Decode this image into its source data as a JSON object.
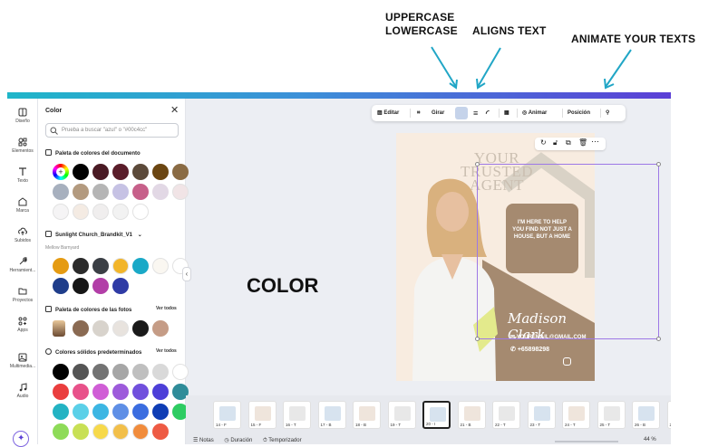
{
  "annotations": {
    "uppercase": "UPPERCASE",
    "lowercase": "LOWERCASE",
    "aligns": "ALIGNS TEXT",
    "animate": "ANIMATE YOUR TEXTS",
    "color": "COLOR"
  },
  "rail": [
    {
      "label": "Diseño",
      "icon": "layout-icon"
    },
    {
      "label": "Elementos",
      "icon": "elements-icon"
    },
    {
      "label": "Texto",
      "icon": "text-icon"
    },
    {
      "label": "Marca",
      "icon": "brand-icon"
    },
    {
      "label": "Subidos",
      "icon": "upload-icon"
    },
    {
      "label": "Herramient...",
      "icon": "tools-icon"
    },
    {
      "label": "Proyectos",
      "icon": "folder-icon"
    },
    {
      "label": "Apps",
      "icon": "apps-icon"
    },
    {
      "label": "Multimedia...",
      "icon": "media-icon"
    },
    {
      "label": "Audio",
      "icon": "audio-icon"
    }
  ],
  "panel": {
    "title": "Color",
    "search_placeholder": "Prueba a buscar \"azul\" o \"#00c4cc\"",
    "doc_palette_title": "Paleta de colores del documento",
    "brandkit_title": "Sunlight Church_Brandkit_V1",
    "brandkit_sub": "Mellow Barnyard",
    "photo_palette_title": "Paleta de colores de las fotos",
    "photo_see_all": "Ver todos",
    "solid_title": "Colores sólidos predeterminados",
    "solid_see_all": "Ver todos",
    "doc_colors": [
      "#000000",
      "#4a1a24",
      "#5a1d2a",
      "#5c4a3a",
      "#6b4612",
      "#8a6b44",
      "#a7b0be",
      "#b39a7f",
      "#b5b5b5",
      "#c6c2e4",
      "#c7608a",
      "#e2d8e5",
      "#f1e4e6",
      "#f5f4f5",
      "#f4ebe3",
      "#f0eeee",
      "#f2f2f2",
      "#ffffff"
    ],
    "brand_colors": [
      "#e59b12",
      "#2b2b2b",
      "#3b3f45",
      "#f2b52a",
      "#1aa9c7",
      "#faf7f1",
      "#ffffff",
      "#1f3d8a",
      "#161616",
      "#b23ea7",
      "#2f3ba5"
    ],
    "photo_colors": [
      "#8a6a52",
      "#d8d3cc",
      "#e8e3de",
      "#1a1a1a",
      "#c59c86"
    ],
    "solid_colors": [
      "#000000",
      "#555555",
      "#737373",
      "#a6a6a6",
      "#bfbfbf",
      "#d9d9d9",
      "#ffffff",
      "#ea3e3e",
      "#e8528a",
      "#d05ed6",
      "#9d5bdb",
      "#7150dd",
      "#4d3fd8",
      "#2f8c99",
      "#23b3c3",
      "#5bd0e8",
      "#3cb6e3",
      "#5f8fe6",
      "#3b6de0",
      "#0f3db5",
      "#2ecc62",
      "#8edb58",
      "#c8e055",
      "#f7d94b",
      "#f2bf4a",
      "#f18c3c",
      "#ee5b44"
    ]
  },
  "toolbar": {
    "edit": "Editar",
    "rotate": "Girar",
    "animate": "Animar",
    "position": "Posición"
  },
  "design": {
    "headline": "YOUR TRUSTED AGENT",
    "bubble_text": "I'M HERE TO HELP YOU FIND NOT JUST A HOUSE, BUT A HOME",
    "signature": "Madison Clark",
    "email": "YOUREMAIL@GMAIL.COM",
    "phone": "+65898298"
  },
  "thumbnails": [
    "14 - F",
    "15 - F",
    "16 - T",
    "17 - B",
    "18 - B",
    "19 - T",
    "20 - I",
    "21 - B",
    "22 - T",
    "23 - T",
    "24 - T",
    "25 - T",
    "26 - B",
    "27 - T"
  ],
  "status": {
    "notes": "Notas",
    "duration": "Duración",
    "timer": "Temporizador",
    "zoom": "44 %"
  },
  "colors": {
    "accent": "#7d2ae8",
    "brown": "#a58a70",
    "cream": "#f8ece0"
  }
}
